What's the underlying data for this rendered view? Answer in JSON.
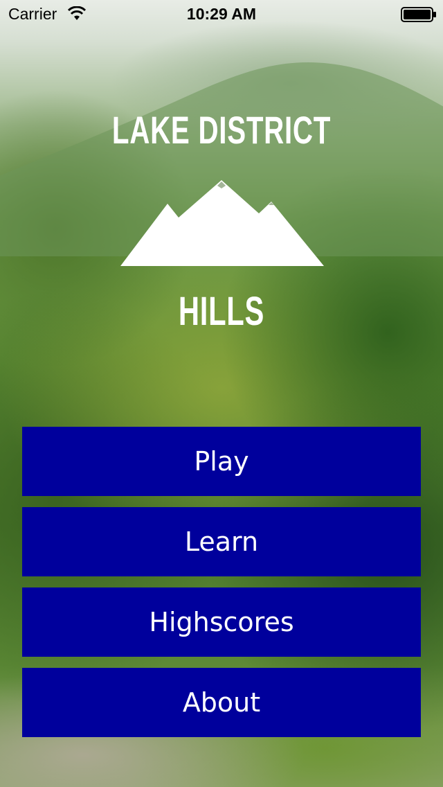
{
  "status_bar": {
    "carrier": "Carrier",
    "time": "10:29 AM",
    "wifi_icon": "wifi-icon",
    "battery_icon": "battery-full-icon"
  },
  "logo": {
    "line1": "LAKE DISTRICT",
    "line2": "HILLS",
    "icon": "mountain-icon"
  },
  "menu": {
    "buttons": [
      {
        "label": "Play"
      },
      {
        "label": "Learn"
      },
      {
        "label": "Highscores"
      },
      {
        "label": "About"
      }
    ],
    "button_color": "#00009c",
    "text_color": "#ffffff"
  }
}
